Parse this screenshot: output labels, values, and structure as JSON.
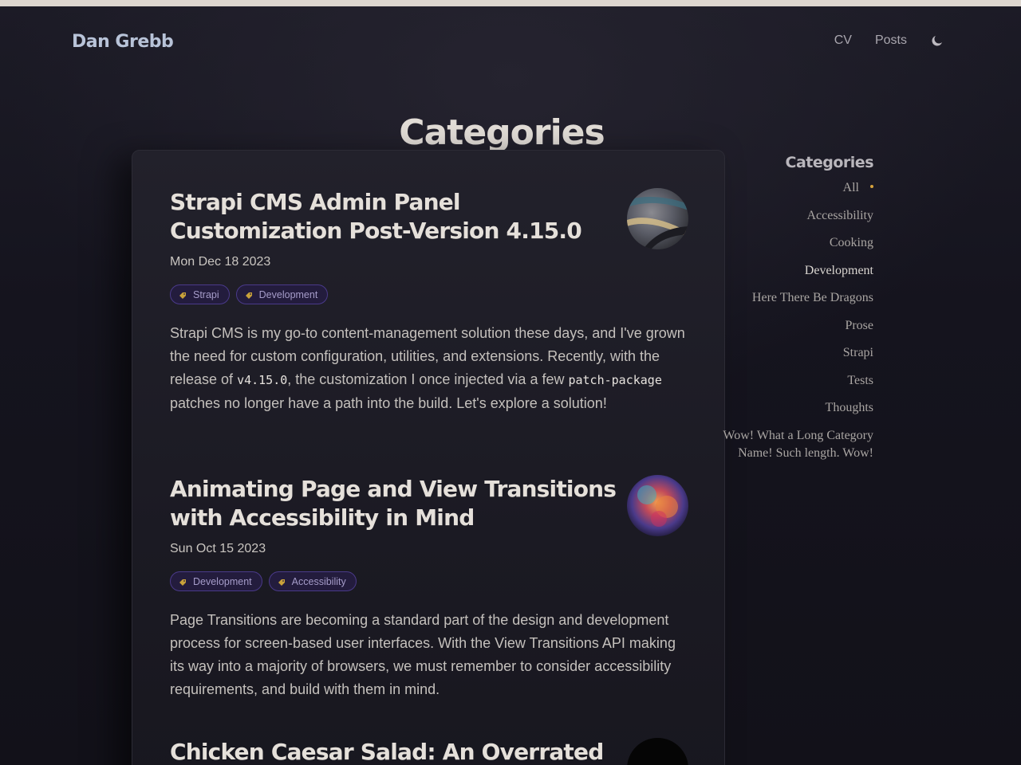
{
  "site": {
    "title": "Dan Grebb"
  },
  "nav": {
    "items": [
      {
        "label": "CV"
      },
      {
        "label": "Posts"
      }
    ],
    "theme_toggle_icon": "moon-icon"
  },
  "page": {
    "title": "Categories"
  },
  "posts": [
    {
      "title": "Strapi CMS Admin Panel Customization Post-Version 4.15.0",
      "date": "Mon Dec 18 2023",
      "tags": [
        "Strapi",
        "Development"
      ],
      "excerpt": {
        "part1": "Strapi CMS is my go-to content-management solution these days, and I've grown the need for custom configuration, utilities, and extensions. Recently, with the release of ",
        "code1": "v4.15.0",
        "part2": ", the customization I once injected via a few ",
        "code2": "patch-package",
        "part3": " patches no longer have a path into the build. Let's explore a solution!"
      },
      "thumb_icon": "abstract-image-thumbnail"
    },
    {
      "title": "Animating Page and View Transitions with Accessibility in Mind",
      "date": "Sun Oct 15 2023",
      "tags": [
        "Development",
        "Accessibility"
      ],
      "excerpt": {
        "part1": "Page Transitions are becoming a standard part of the design and development process for screen-based user interfaces. With the View Transitions API making its way into a majority of browsers, we must remember to consider accessibility requirements, and build with them in mind."
      },
      "thumb_icon": "colorful-cloud-thumbnail"
    },
    {
      "title": "Chicken Caesar Salad: An Overrated",
      "thumb_icon": "dark-thumbnail"
    }
  ],
  "sidebar": {
    "heading": "Categories",
    "items": [
      {
        "label": "All"
      },
      {
        "label": "Accessibility"
      },
      {
        "label": "Cooking"
      },
      {
        "label": "Development"
      },
      {
        "label": "Here There Be Dragons"
      },
      {
        "label": "Prose"
      },
      {
        "label": "Strapi"
      },
      {
        "label": "Tests"
      },
      {
        "label": "Thoughts"
      },
      {
        "label": "Wow! What a Long Category Name! Such length. Wow!"
      }
    ]
  },
  "colors": {
    "background": "#15141f",
    "accent_dot": "#d7a33c",
    "tag_border": "#4a3a8a",
    "logo": "#b8c3d8"
  }
}
